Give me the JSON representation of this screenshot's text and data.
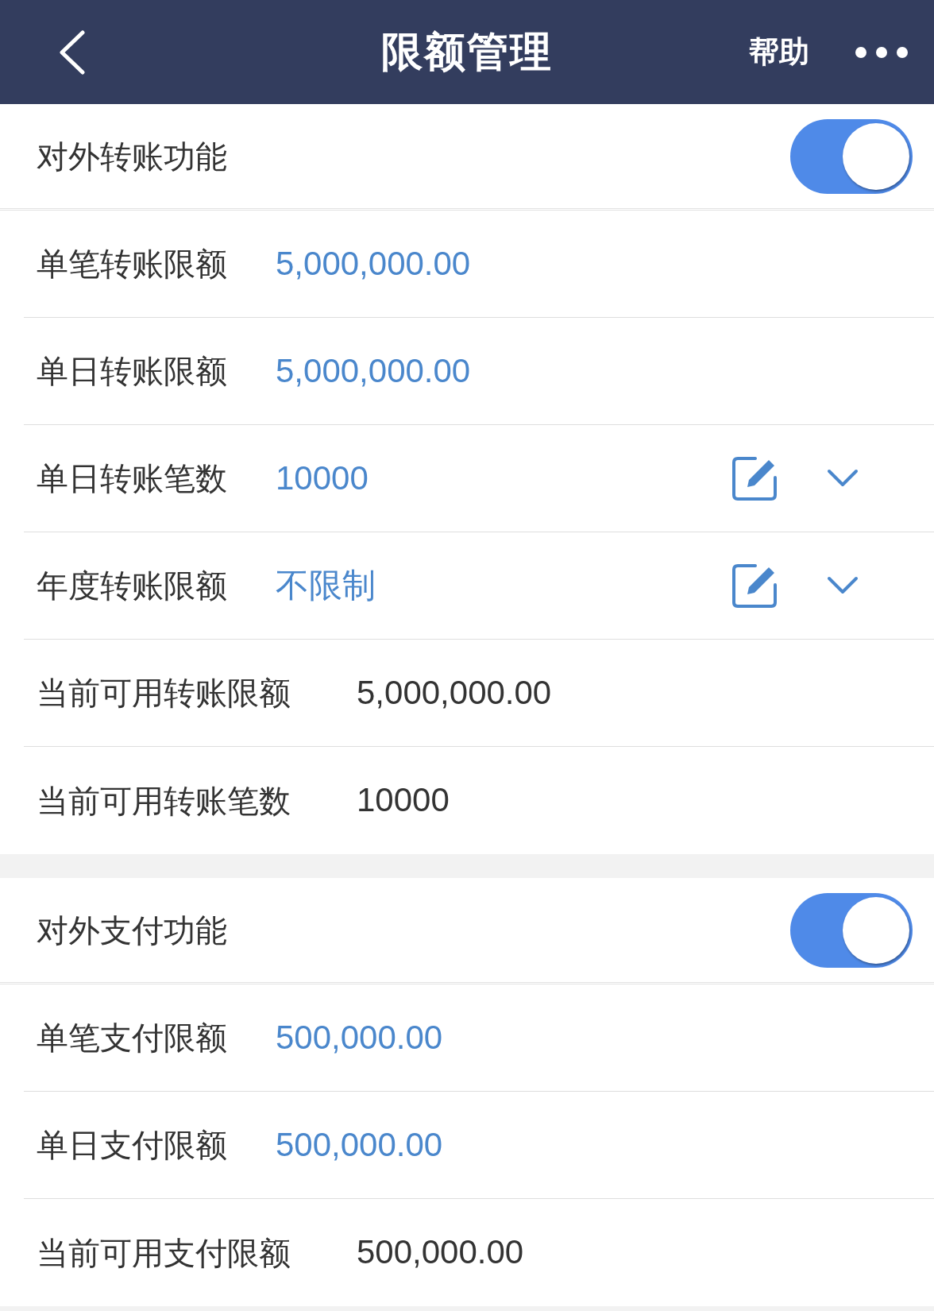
{
  "header": {
    "title": "限额管理",
    "help": "帮助"
  },
  "sections": [
    {
      "toggle": {
        "label": "对外转账功能",
        "on": true
      },
      "rows": [
        {
          "kind": "limit",
          "label": "单笔转账限额",
          "value": "5,000,000.00"
        },
        {
          "kind": "limit",
          "label": "单日转账限额",
          "value": "5,000,000.00"
        },
        {
          "kind": "editable",
          "label": "单日转账笔数",
          "value": "10000"
        },
        {
          "kind": "editable",
          "label": "年度转账限额",
          "value": "不限制"
        },
        {
          "kind": "available",
          "label": "当前可用转账限额",
          "value": "5,000,000.00"
        },
        {
          "kind": "available",
          "label": "当前可用转账笔数",
          "value": "10000"
        }
      ]
    },
    {
      "toggle": {
        "label": "对外支付功能",
        "on": true
      },
      "rows": [
        {
          "kind": "limit",
          "label": "单笔支付限额",
          "value": "500,000.00"
        },
        {
          "kind": "limit",
          "label": "单日支付限额",
          "value": "500,000.00"
        },
        {
          "kind": "available",
          "label": "当前可用支付限额",
          "value": "500,000.00"
        }
      ]
    }
  ]
}
